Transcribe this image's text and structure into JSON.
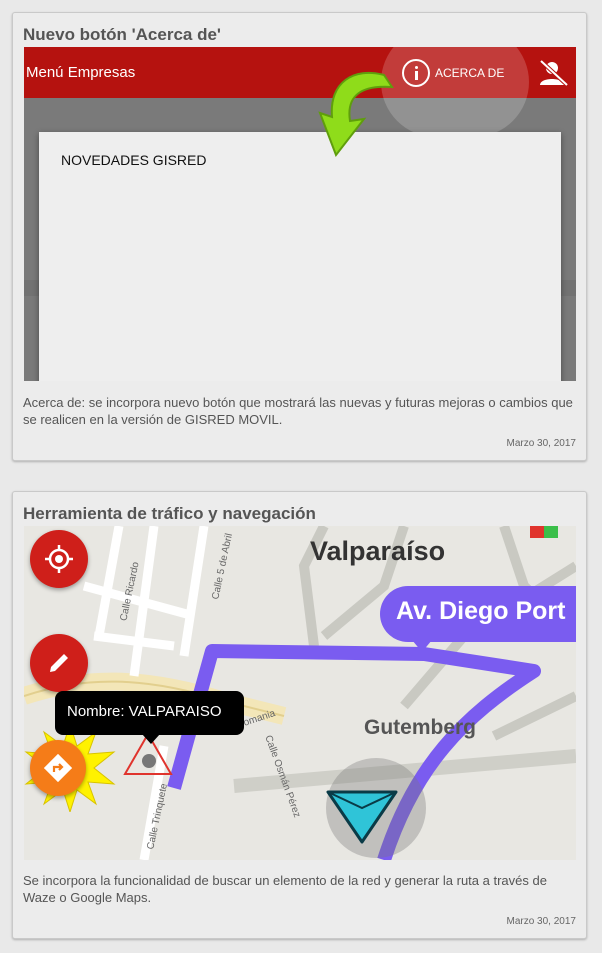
{
  "cards": [
    {
      "title": "Nuevo botón 'Acerca de'",
      "screenshot": {
        "app_bar_title": "Menú Empresas",
        "about_button_label": "ACERCA DE",
        "dialog_title": "NOVEDADES GISRED"
      },
      "description": "Acerca de: se incorpora nuevo botón que mostrará las nuevas y futuras mejoras o cambios que se realicen en la versión de GISRED MOVIL.",
      "date": "Marzo 30, 2017"
    },
    {
      "title": "Herramienta de tráfico y navegación",
      "screenshot": {
        "city_label": "Valparaíso",
        "route_label": "Av. Diego Port",
        "street_label": "Gutemberg",
        "tooltip": "Nombre: VALPARAISO",
        "map_streets": [
          "Calle Ricardo",
          "Calle 5 de Abril",
          "Romania",
          "Calle Osmán Pérez",
          "Calle Trinquete"
        ]
      },
      "description": "Se incorpora la funcionalidad de buscar un elemento de la red y generar la ruta a través de Waze o Google Maps.",
      "date": "Marzo 30, 2017"
    }
  ],
  "colors": {
    "app_bar": "#b5120f",
    "fab": "#cf1f1a",
    "route": "#7a5cf0",
    "nav_arrow": "#2fc4d8",
    "green_arrow": "#8fdc1a"
  },
  "icons": [
    "info-icon",
    "user-off-icon",
    "green-arrow-icon",
    "location-target-icon",
    "pencil-icon",
    "directions-icon",
    "warning-triangle-icon",
    "navigation-arrow-icon"
  ]
}
